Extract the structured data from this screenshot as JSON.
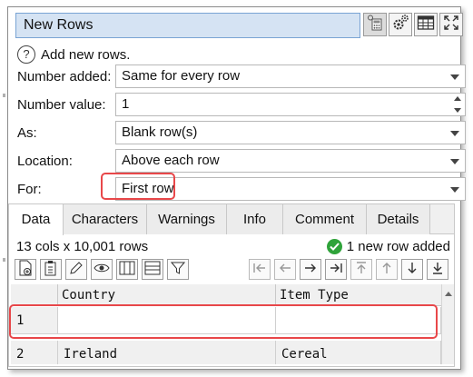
{
  "window": {
    "title": "New Rows",
    "icons": [
      "calculator-icon",
      "gears-icon",
      "table-icon",
      "fullscreen-icon"
    ]
  },
  "help": {
    "text": "Add new rows."
  },
  "form": {
    "number_added": {
      "label": "Number added:",
      "value": "Same for every row"
    },
    "number_value": {
      "label": "Number value:",
      "value": "1"
    },
    "as": {
      "label": "As:",
      "value": "Blank row(s)"
    },
    "location": {
      "label": "Location:",
      "value": "Above each row"
    },
    "for": {
      "label": "For:",
      "value": "First row"
    }
  },
  "tabs": [
    "Data",
    "Characters",
    "Warnings",
    "Info",
    "Comment",
    "Details"
  ],
  "active_tab": "Data",
  "data_panel": {
    "row_count": "13 cols x 10,001 rows",
    "new_rows_status": "1 new row added",
    "toolbar_icons": [
      "insert-row-icon",
      "paste-icon",
      "edit-pencil-icon",
      "eye-icon",
      "columns-icon",
      "rows-icon",
      "filter-icon",
      "first-icon",
      "prev-icon",
      "next-icon",
      "last-icon",
      "top-icon",
      "up-icon",
      "down-icon",
      "bottom-icon"
    ]
  },
  "grid": {
    "columns": [
      "Country",
      "Item Type"
    ],
    "rows": [
      {
        "index": "1",
        "cells": [
          "",
          ""
        ]
      },
      {
        "index": "2",
        "cells": [
          "Ireland",
          "Cereal"
        ]
      }
    ]
  },
  "colors": {
    "title_bg": "#d5e3f3",
    "title_border": "#7aa4d4",
    "highlight": "#e8474a",
    "check_green": "#2fa33a"
  }
}
